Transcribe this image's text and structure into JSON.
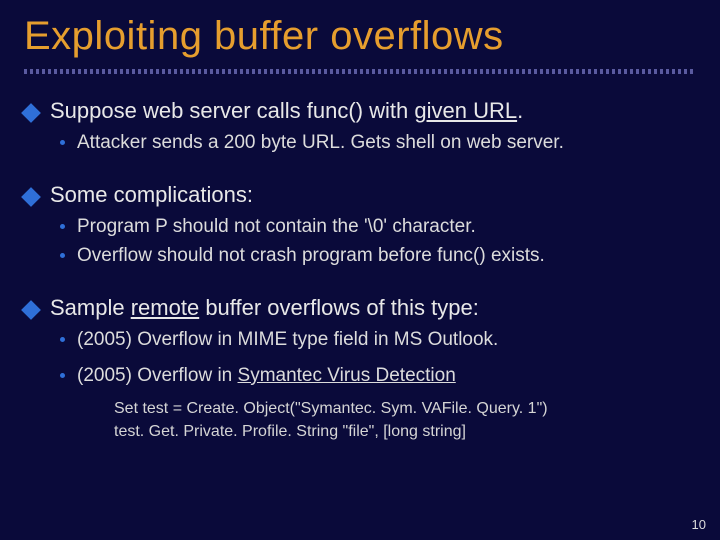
{
  "title": "Exploiting buffer overflows",
  "b1": {
    "head": "Suppose web server calls  func()  with ",
    "head_u": "given URL",
    "head_tail": ".",
    "sub1": "Attacker sends a 200 byte URL.  Gets shell on web server."
  },
  "b2": {
    "head": "Some complications:",
    "sub1": "Program   P  should not contain the  '\\0'  character.",
    "sub2": "Overflow should not crash program before  func()  exists."
  },
  "b3": {
    "head_pre": "Sample ",
    "head_u": "remote",
    "head_post": " buffer overflows of this type:",
    "sub1": "(2005)  Overflow in MIME type field in MS Outlook.",
    "sub2_pre": "(2005)  Overflow in ",
    "sub2_link": "Symantec Virus Detection"
  },
  "code": {
    "l1": "Set test = Create. Object(\"Symantec. Sym. VAFile. Query. 1\")",
    "l2": "test. Get. Private. Profile. String   \"file\",  [long string]"
  },
  "page": "10"
}
